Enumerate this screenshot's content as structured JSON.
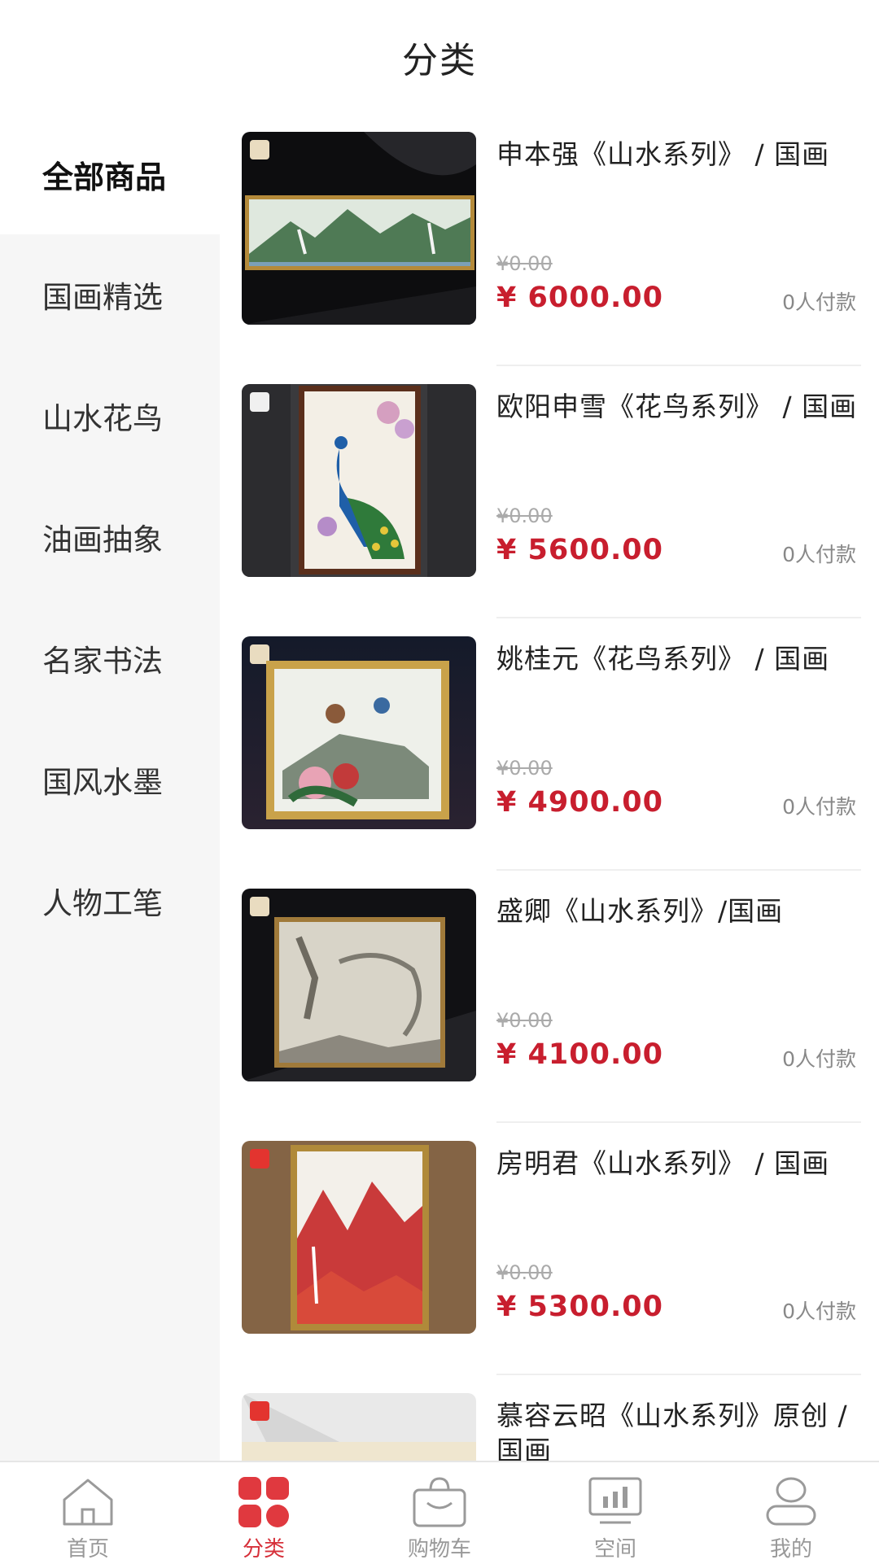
{
  "header": {
    "title": "分类"
  },
  "sidebar": {
    "items": [
      {
        "label": "全部商品"
      },
      {
        "label": "国画精选"
      },
      {
        "label": "山水花鸟"
      },
      {
        "label": "油画抽象"
      },
      {
        "label": "名家书法"
      },
      {
        "label": "国风水墨"
      },
      {
        "label": "人物工笔"
      }
    ]
  },
  "products": [
    {
      "title": "申本强《山水系列》 / 国画",
      "old_price": "¥0.00",
      "price": "¥ 6000.00",
      "sales": "0人付款"
    },
    {
      "title": "欧阳申雪《花鸟系列》 / 国画",
      "old_price": "¥0.00",
      "price": "¥ 5600.00",
      "sales": "0人付款"
    },
    {
      "title": "姚桂元《花鸟系列》 / 国画",
      "old_price": "¥0.00",
      "price": "¥ 4900.00",
      "sales": "0人付款"
    },
    {
      "title": "盛卿《山水系列》/国画",
      "old_price": "¥0.00",
      "price": "¥ 4100.00",
      "sales": "0人付款"
    },
    {
      "title": "房明君《山水系列》 / 国画",
      "old_price": "¥0.00",
      "price": "¥ 5300.00",
      "sales": "0人付款"
    },
    {
      "title": "慕容云昭《山水系列》原创 / 国画",
      "old_price": "",
      "price": "",
      "sales": ""
    }
  ],
  "tabbar": {
    "items": [
      {
        "label": "首页",
        "icon": "home-icon"
      },
      {
        "label": "分类",
        "icon": "category-icon"
      },
      {
        "label": "购物车",
        "icon": "cart-icon"
      },
      {
        "label": "空间",
        "icon": "space-icon"
      },
      {
        "label": "我的",
        "icon": "profile-icon"
      }
    ]
  },
  "colors": {
    "accent": "#d6303a",
    "price": "#c81e2e",
    "sidebar_bg": "#f6f6f6"
  }
}
